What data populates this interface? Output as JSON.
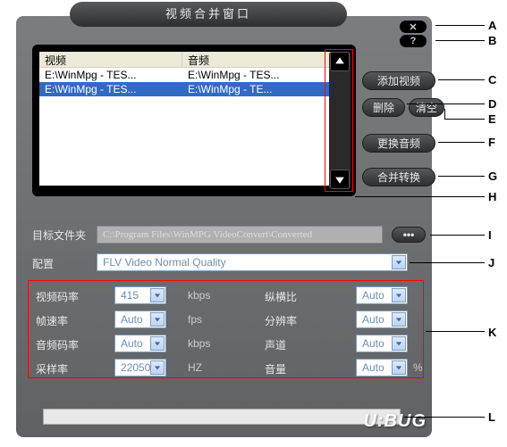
{
  "window": {
    "title": "视频合并窗口"
  },
  "win_close": "✕",
  "win_help": "?",
  "list": {
    "head_video": "视频",
    "head_audio": "音频",
    "rows": [
      {
        "video": "E:\\WinMpg - TES...",
        "audio": "E:\\WinMpg - TES..."
      },
      {
        "video": "E:\\WinMpg - TES...",
        "audio": "E:\\WinMpg - TE..."
      }
    ]
  },
  "buttons": {
    "add_video": "添加视频",
    "delete": "删除",
    "clear": "清空",
    "replace_audio": "更换音频",
    "merge_convert": "合并转换",
    "browse": "•••"
  },
  "labels": {
    "dest_folder": "目标文件夹",
    "config": "配置",
    "video_bitrate": "视频码率",
    "framerate": "帧速率",
    "audio_bitrate": "音频码率",
    "samplerate": "采样率",
    "aspect": "纵横比",
    "resolution": "分辨率",
    "channels": "声道",
    "volume": "音量"
  },
  "values": {
    "dest_folder": "C:\\Program Files\\WinMPG VideoConvert\\Converted",
    "config": "FLV Video Normal Quality",
    "video_bitrate": "415",
    "framerate": "Auto",
    "audio_bitrate": "Auto",
    "samplerate": "22050",
    "aspect": "Auto",
    "resolution": "Auto",
    "channels": "Auto",
    "volume": "Auto"
  },
  "units": {
    "kbps": "kbps",
    "fps": "fps",
    "hz": "HZ",
    "percent": "%"
  },
  "annots": {
    "A": "A",
    "B": "B",
    "C": "C",
    "D": "D",
    "E": "E",
    "F": "F",
    "G": "G",
    "H": "H",
    "I": "I",
    "J": "J",
    "K": "K",
    "L": "L"
  },
  "brand": "U:BUG"
}
